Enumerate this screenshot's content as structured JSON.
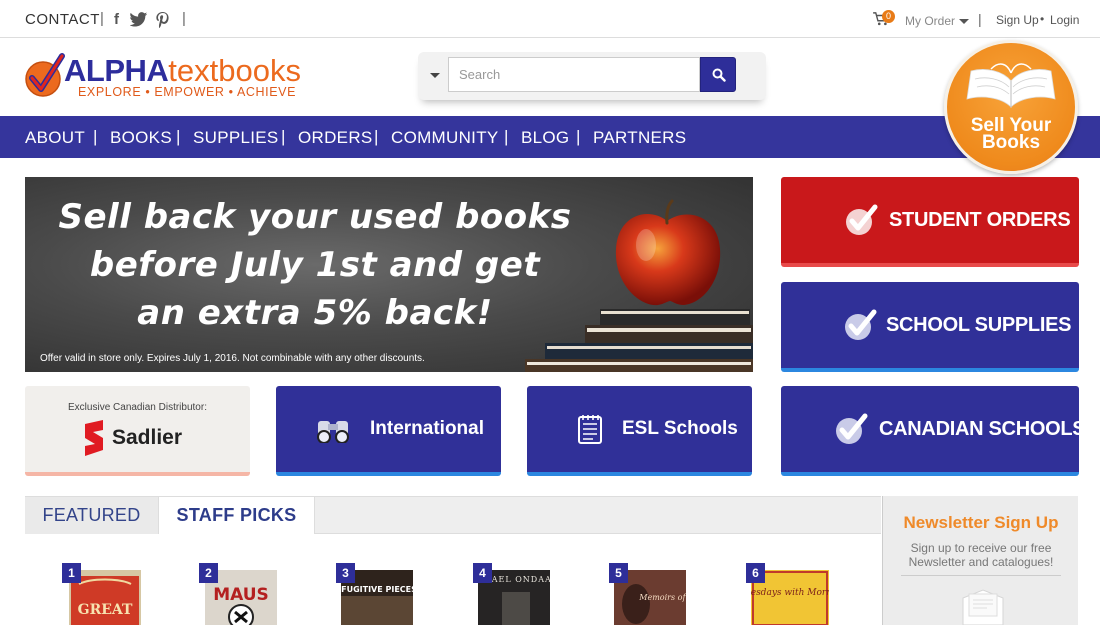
{
  "topbar": {
    "contact": "CONTACT",
    "social": [
      "f",
      "twitter",
      "pinterest"
    ],
    "cart_count": "0",
    "my_order": "My Order",
    "sign_up": "Sign Up",
    "separator_dot": "•",
    "login": "Login"
  },
  "logo": {
    "alpha": "ALPHA",
    "textbooks": "textbooks",
    "tagline": "EXPLORE  •  EMPOWER  •  ACHIEVE"
  },
  "search": {
    "placeholder": "Search"
  },
  "nav": {
    "items": [
      "ABOUT",
      "BOOKS",
      "SUPPLIES",
      "ORDERS",
      "COMMUNITY",
      "BLOG",
      "PARTNERS"
    ]
  },
  "sell_badge": {
    "line1": "Sell Your",
    "line2": "Books"
  },
  "hero": {
    "line1": "Sell back your used books",
    "line2": "before July 1st and get",
    "line3": "an extra 5% back!",
    "fine_print": "Offer valid in store only. Expires July 1, 2016. Not combinable with any other discounts."
  },
  "buttons": {
    "student_orders": "STUDENT ORDERS",
    "school_supplies": "SCHOOL SUPPLIES",
    "canadian_schools": "CANADIAN SCHOOLS",
    "international": "International",
    "esl_schools": "ESL Schools"
  },
  "sadlier": {
    "caption": "Exclusive Canadian Distributor:",
    "name": "Sadlier"
  },
  "tabs": {
    "featured": "FEATURED",
    "staff_picks": "STAFF PICKS"
  },
  "books": [
    {
      "num": "1",
      "title": "GREAT",
      "color": "#d8c8a8"
    },
    {
      "num": "2",
      "title": "MAUS",
      "color": "#d9d3c8"
    },
    {
      "num": "3",
      "title": "FUGITIVE PIECES",
      "color": "#3a2c22"
    },
    {
      "num": "4",
      "title": "MICHAEL ONDAATJE",
      "color": "#2c2a2a"
    },
    {
      "num": "5",
      "title": "Memoirs of a",
      "color": "#6a3a30"
    },
    {
      "num": "6",
      "title": "tuesdays with Morrie",
      "color": "#f0c533"
    }
  ],
  "newsletter": {
    "title": "Newsletter Sign Up",
    "text": "Sign up to receive our free Newsletter and catalogues!"
  },
  "colors": {
    "brand_blue": "#35359c",
    "brand_orange": "#ec6a1e",
    "student_red": "#c9181b",
    "accent_light_blue": "#2b87e0"
  }
}
